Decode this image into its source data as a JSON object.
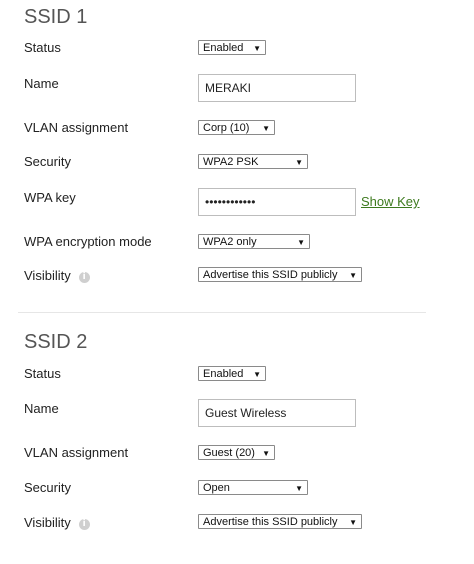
{
  "ssid1": {
    "title": "SSID 1",
    "status": {
      "label": "Status",
      "value": "Enabled"
    },
    "name": {
      "label": "Name",
      "value": "MERAKI"
    },
    "vlan": {
      "label": "VLAN assignment",
      "value": "Corp (10)"
    },
    "security": {
      "label": "Security",
      "value": "WPA2 PSK"
    },
    "wpa_key": {
      "label": "WPA key",
      "value": "••••••••••••",
      "show_key_label": "Show Key"
    },
    "wpa_mode": {
      "label": "WPA encryption mode",
      "value": "WPA2 only"
    },
    "visibility": {
      "label": "Visibility",
      "value": "Advertise this SSID publicly"
    }
  },
  "ssid2": {
    "title": "SSID 2",
    "status": {
      "label": "Status",
      "value": "Enabled"
    },
    "name": {
      "label": "Name",
      "value": "Guest Wireless"
    },
    "vlan": {
      "label": "VLAN assignment",
      "value": "Guest (20)"
    },
    "security": {
      "label": "Security",
      "value": "Open"
    },
    "visibility": {
      "label": "Visibility",
      "value": "Advertise this SSID publicly"
    }
  },
  "icons": {
    "dropdown": "▼",
    "info": "i"
  },
  "colors": {
    "link": "#3d7a1e",
    "info_icon": "#cfcfcf"
  }
}
